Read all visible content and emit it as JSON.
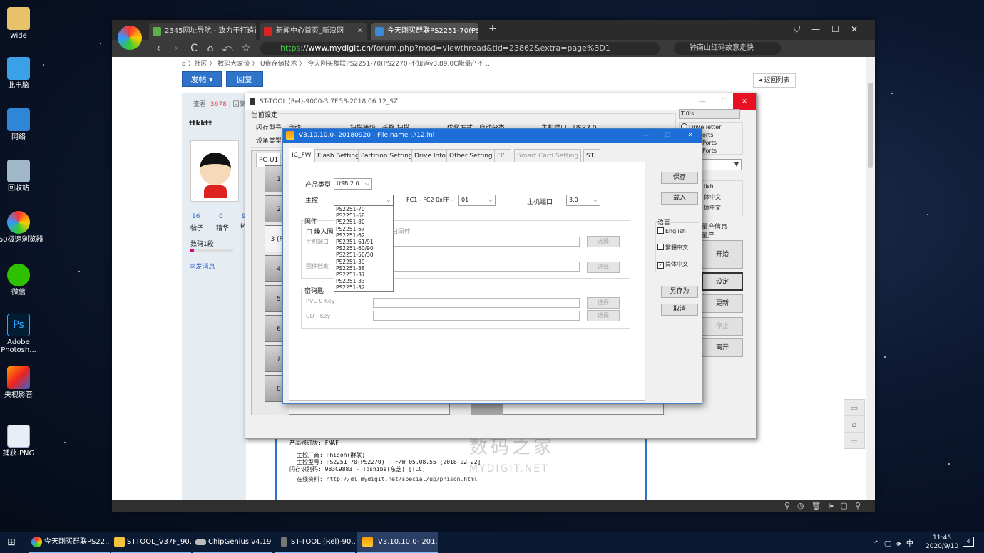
{
  "desktop": {
    "icons": [
      {
        "label": "wide"
      },
      {
        "label": "此电脑"
      },
      {
        "label": "网络"
      },
      {
        "label": "回收站"
      },
      {
        "label": "360极速浏览器"
      },
      {
        "label": "微信"
      },
      {
        "label": "Adobe Photosh..."
      },
      {
        "label": "央视影音"
      },
      {
        "label": "捕获.PNG"
      }
    ]
  },
  "browser": {
    "tabs": [
      {
        "title": "2345网址导航 - 致力于打造百"
      },
      {
        "title": "新闻中心首页_新浪网"
      },
      {
        "title": "今天刚买群联PS2251-70(PS2"
      }
    ],
    "new_tab": "+",
    "url_scheme": "https",
    "url_host": "://www.mydigit.cn",
    "url_path": "/forum.php?mod=viewthread&tid=23862&extra=page%3D1",
    "search_text": "钟南山红码故意走快",
    "window_controls": {
      "min": "—",
      "max": "☐",
      "close": "✕"
    },
    "nav": {
      "back": "‹",
      "forward": "›",
      "reload": "C",
      "home": "⌂",
      "undo": "⤺",
      "star": "☆"
    }
  },
  "forum": {
    "breadcrumb": "⌂ 〉社区 〉 数码大家谈 〉 U盘存储技术 〉 今天刚买群联PS2251-70(PS2270)不知道v3.89.0C能量产不 ...",
    "post_button": "发帖 ▾",
    "reply_button": "回复",
    "back_list": "◂ 返回列表",
    "view_label": "查看:",
    "view_count": "3678",
    "reply_label": "回复",
    "username": "ttkktt",
    "stats": [
      {
        "value": "16",
        "label": "帖子"
      },
      {
        "value": "0",
        "label": "精华"
      },
      {
        "value": "9",
        "label": "M"
      }
    ],
    "rank": "数码1段",
    "message_link": "发消息",
    "post_text": {
      "line1": "产品修订版: FNAF",
      "line2": "主控厂商: Phison(群联)",
      "line3": "主控型号: PS2251-70(PS2270) - F/W 05.08.55 [2018-02-22]",
      "line4": "闪存识别码: 983C9883 - Toshiba(东芝) [TLC]",
      "line5": "在线资料: http://dl.mydigit.net/special/up/phison.html"
    },
    "watermark": "数码之家",
    "watermark_sub": "MYDIGIT.NET"
  },
  "sttool": {
    "title": "ST-TOOL (Rel)-9000-3.7F.53-2018.06.12_SZ",
    "section": "当前设定",
    "flash_type": "闪存型号 : 自动",
    "scan_level": "扫描等级 : 长格 扫描",
    "opt_mode": "优化方式 : 自动分类",
    "host_port": "主机端口 : USB3.0",
    "device_type": "设备类型",
    "pc_tab": "PC-U1",
    "ports": [
      "1",
      "2",
      "3 (F:)",
      "4",
      "5",
      "6",
      "7",
      "8"
    ],
    "right_top": "T:0's",
    "drive_opts": [
      "Drive letter",
      "orts",
      "Ports",
      "Ports"
    ],
    "lang_opts": [
      "lish",
      "体中文",
      "体中文"
    ],
    "mp_info": "量产信息",
    "mp": "量产",
    "buttons": {
      "start": "开始",
      "settings": "设定",
      "refresh": "更新",
      "stop": "停止",
      "exit": "离开"
    }
  },
  "v3": {
    "title": "V3.10.10.0- 20180920 - File name :.\\12.ini",
    "tabs": [
      "IC_FW",
      "Flash Setting",
      "Partition Setting",
      "Drive Info",
      "Other Setting",
      "FP",
      "Smart Card Setting",
      "ST"
    ],
    "product_type_label": "产品类型",
    "product_type_value": "USB 2.0",
    "controller_label": "主控",
    "controller_value": "",
    "fc_label": "FC1 - FC2   0xFF -",
    "fc_value": "01",
    "host_port_label": "主机端口",
    "host_port_value": "3.0",
    "firmware_group": "固件",
    "load_firmware": "□ 燥入固",
    "old_firmware": "旧固件",
    "host_port_fw": "主机端口",
    "fw_file": "固件档案",
    "key_group": "密码匙",
    "pvc_key": "PVC 0 Key",
    "cd_key": "CD - Key",
    "select": "选择",
    "controller_options": [
      "PS2251-70",
      "PS2251-68",
      "PS2251-80",
      "PS2251-67",
      "PS2251-62",
      "PS2251-61/91",
      "PS2251-60/90",
      "PS2251-50/30",
      "PS2251-39",
      "PS2251-38",
      "PS2251-37",
      "PS2251-33",
      "PS2251-32"
    ],
    "save": "保存",
    "load": "载入",
    "language_label": "语言",
    "lang_en": "English",
    "lang_tc": "繁體中文",
    "lang_sc": "简体中文",
    "save_as": "另存为",
    "cancel": "取消"
  },
  "taskbar": {
    "items": [
      {
        "label": "今天刚买群联PS22..."
      },
      {
        "label": "STTOOL_V37F_90..."
      },
      {
        "label": "ChipGenius v4.19...."
      },
      {
        "label": "ST-TOOL (Rel)-90..."
      },
      {
        "label": "V3.10.10.0- 201..."
      }
    ],
    "tray": "^ 🖵 🕪 中",
    "time": "11:46",
    "date": "2020/9/10",
    "notif_count": "4"
  }
}
